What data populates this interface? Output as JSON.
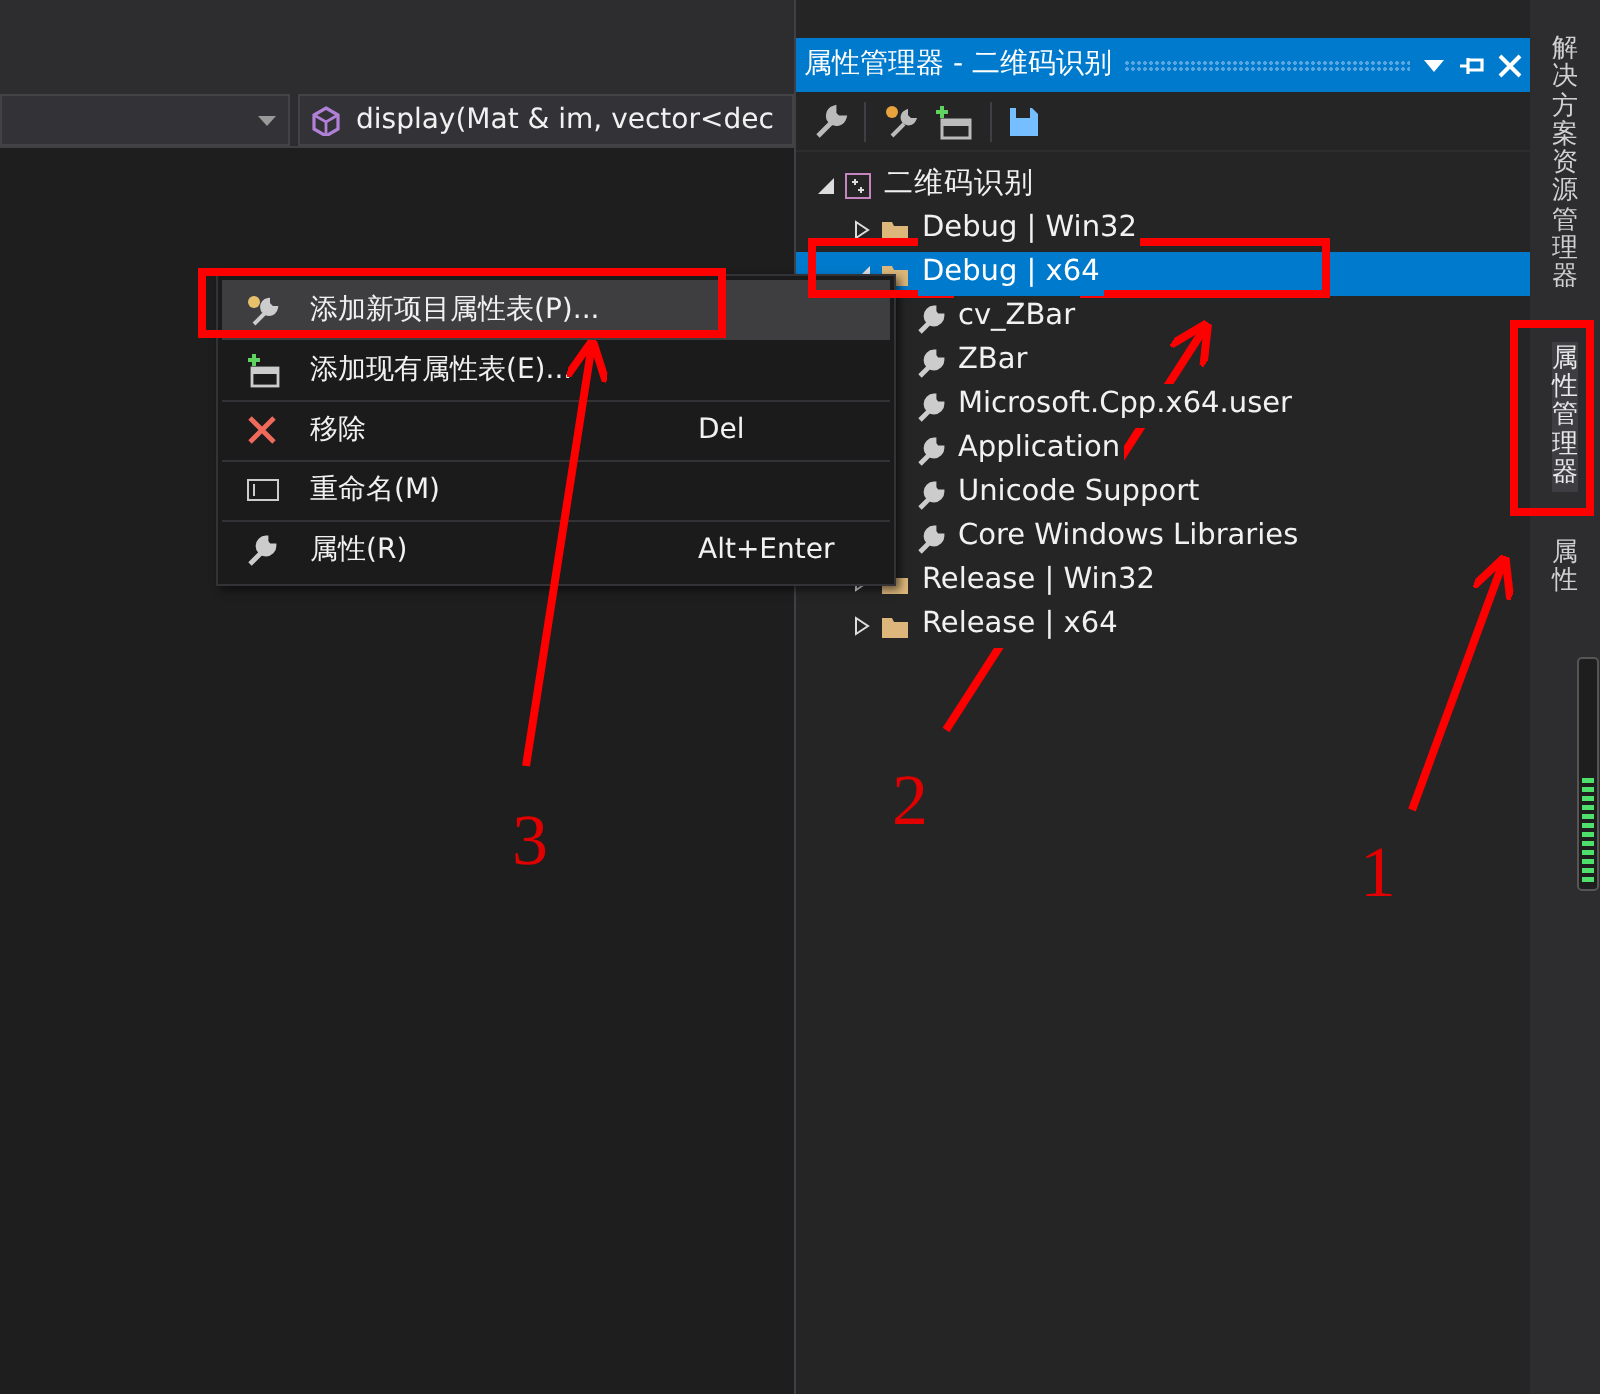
{
  "editor": {
    "member_dropdown": {
      "value": "display(Mat & im, vector<dec"
    }
  },
  "property_manager": {
    "title": "属性管理器 - 二维码识别",
    "tree": [
      {
        "label": "二维码识别",
        "kind": "project",
        "expanded": true,
        "selected": false,
        "children": [
          {
            "label": "Debug | Win32",
            "kind": "config",
            "expanded": false,
            "selected": false
          },
          {
            "label": "Debug | x64",
            "kind": "config",
            "expanded": true,
            "selected": true,
            "children": [
              {
                "label": "cv_ZBar",
                "kind": "sheet",
                "selected": false
              },
              {
                "label": "ZBar",
                "kind": "sheet",
                "selected": false
              },
              {
                "label": "Microsoft.Cpp.x64.user",
                "kind": "sheet",
                "selected": false
              },
              {
                "label": "Application",
                "kind": "sheet",
                "selected": false
              },
              {
                "label": "Unicode Support",
                "kind": "sheet",
                "selected": false
              },
              {
                "label": "Core Windows Libraries",
                "kind": "sheet",
                "selected": false
              }
            ]
          },
          {
            "label": "Release | Win32",
            "kind": "config",
            "expanded": false,
            "selected": false
          },
          {
            "label": "Release | x64",
            "kind": "config",
            "expanded": false,
            "selected": false
          }
        ]
      }
    ]
  },
  "context_menu": [
    {
      "label": "添加新项目属性表(P)...",
      "kind": "new-sheet",
      "selected": true
    },
    {
      "label": "添加现有属性表(E)...",
      "kind": "existing-sheet",
      "selected": false
    },
    {
      "label": "移除",
      "shortcut": "Del",
      "kind": "remove",
      "selected": false
    },
    {
      "label": "重命名(M)",
      "kind": "rename",
      "selected": false
    },
    {
      "label": "属性(R)",
      "shortcut": "Alt+Enter",
      "kind": "properties",
      "selected": false
    }
  ],
  "side_tabs": [
    {
      "label": "解决方案资源管理器",
      "selected": false
    },
    {
      "label": "属性管理器",
      "selected": true
    },
    {
      "label": "属性",
      "selected": false
    }
  ],
  "annotations": [
    {
      "label": "1"
    },
    {
      "label": "2"
    },
    {
      "label": "3"
    }
  ]
}
